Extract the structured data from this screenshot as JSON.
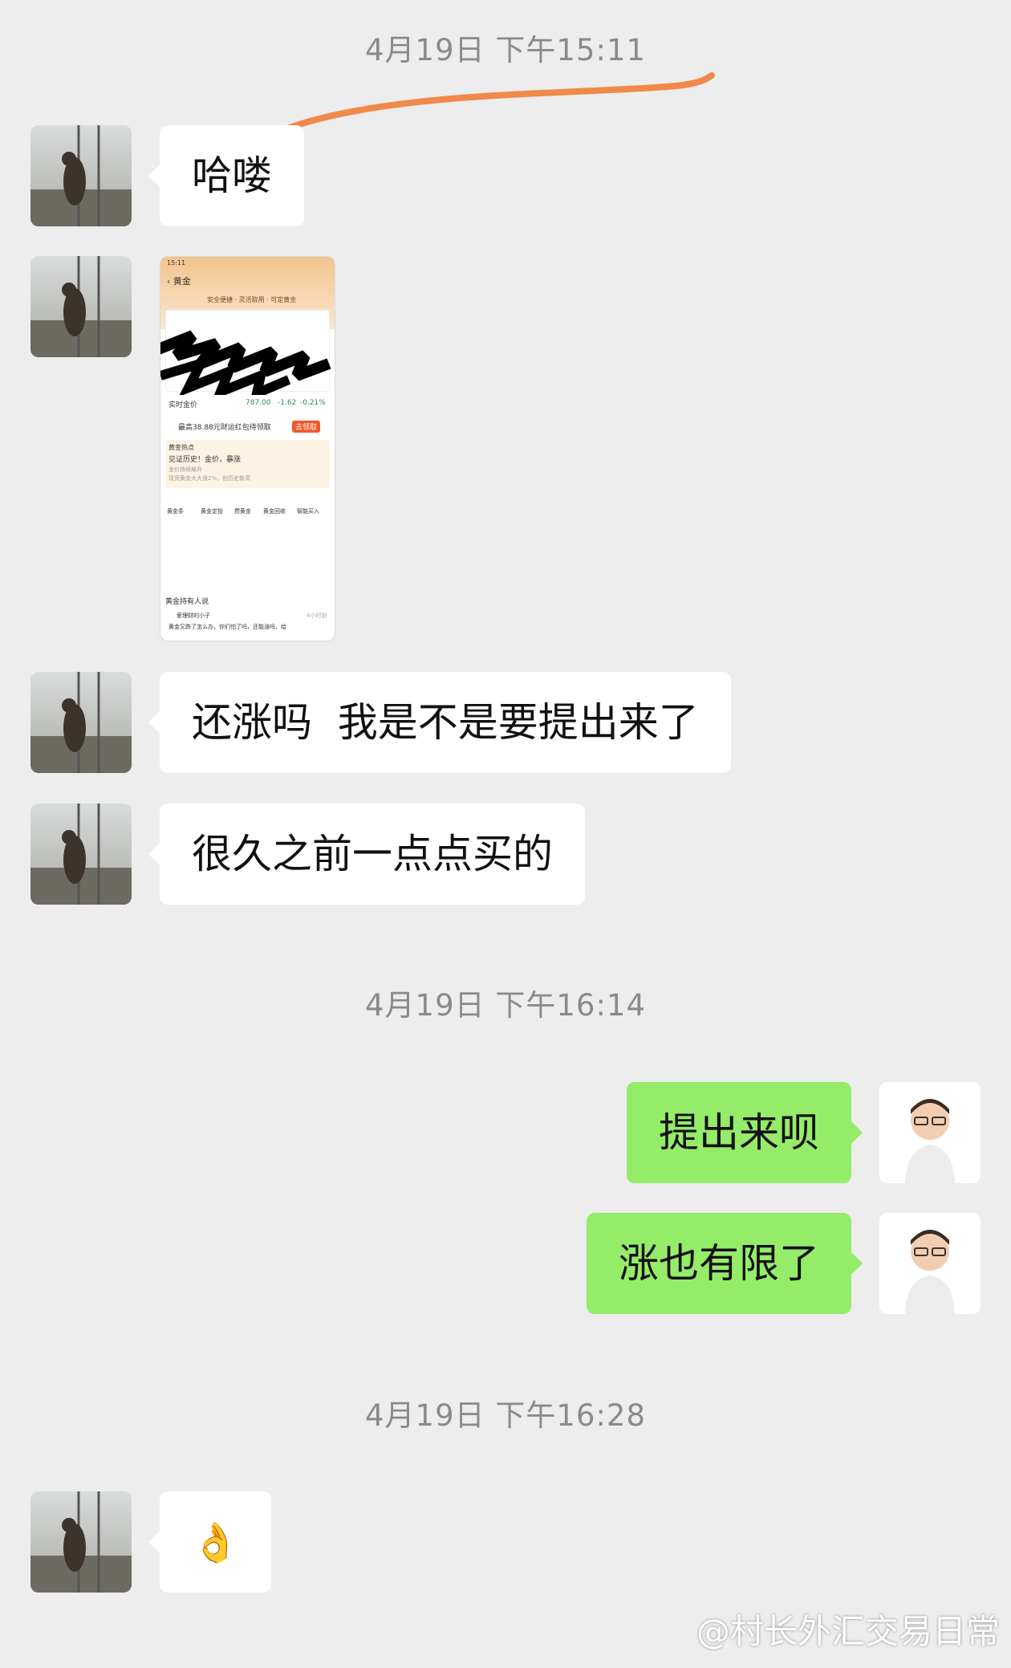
{
  "timestamps": [
    "4月19日 下午15:11",
    "4月19日 下午16:14",
    "4月19日 下午16:28"
  ],
  "messages": {
    "m1": "哈喽",
    "m3": "还涨吗  我是不是要提出来了",
    "m4": "很久之前一点点买的",
    "m5": "提出来呗",
    "m6": "涨也有限了",
    "m7": "👌"
  },
  "shared_screenshot": {
    "title": "黄金",
    "status_time": "15:11",
    "banner": "安全便捷 · 灵活取用 · 可定黄金",
    "price_label": "实时金价",
    "price_value": "787.00",
    "price_change": "-1.62",
    "price_pct": "-0.21%",
    "promo": "最高38.88元财运红包待领取",
    "promo_button": "去领取",
    "hot_tag": "黄金热点",
    "hot_title": "见证历史！金价，暴涨",
    "hot_sub1": "金价持续飙升",
    "hot_sub2": "现货黄金大大涨2%，创历史新高",
    "menu": [
      "黄金条",
      "黄金定投",
      "攒黄金",
      "黄金回收",
      "智能买入"
    ],
    "section": "黄金持有人说",
    "user": "爱理财的小子",
    "time": "4小时前",
    "comment": "黄金又跌了怎么办，你们怕了吗，还能涨吗，给"
  },
  "watermark": "@村长外汇交易日常",
  "colors": {
    "background": "#ededed",
    "sent_bubble": "#95ec69",
    "received_bubble": "#ffffff",
    "annotation": "#f0894a"
  }
}
